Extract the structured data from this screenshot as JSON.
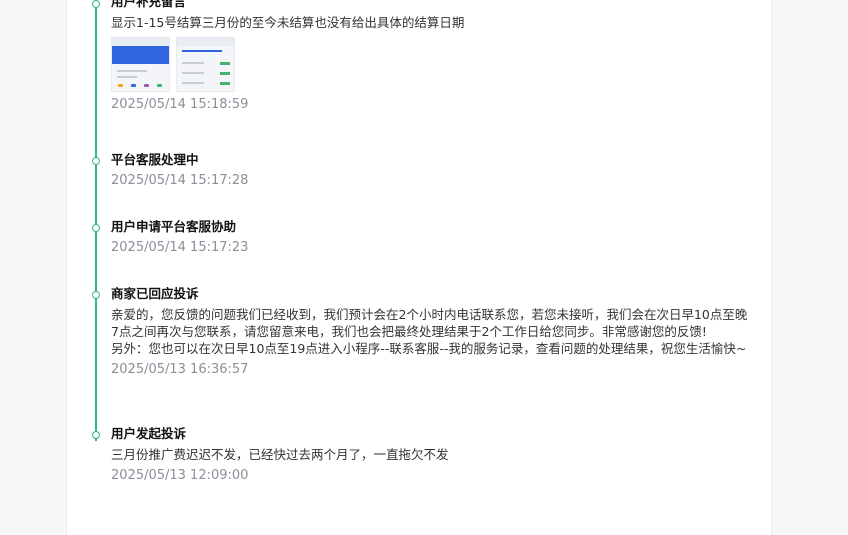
{
  "events": [
    {
      "title": "用户补充留言",
      "body": "显示1-15号结算三月份的至今未结算也没有给出具体的结算日期",
      "time": "2025/05/14 15:18:59",
      "attachments": [
        "screenshot-thumbnail-1",
        "screenshot-thumbnail-2"
      ]
    },
    {
      "title": "平台客服处理中",
      "time": "2025/05/14 15:17:28"
    },
    {
      "title": "用户申请平台客服协助",
      "time": "2025/05/14 15:17:23"
    },
    {
      "title": "商家已回应投诉",
      "body": "亲爱的，您反馈的问题我们已经收到，我们预计会在2个小时内电话联系您，若您未接听，我们会在次日早10点至晚7点之间再次与您联系，请您留意来电，我们也会把最终处理结果于2个工作日给您同步。非常感谢您的反馈!\n另外：您也可以在次日早10点至19点进入小程序--联系客服--我的服务记录，查看问题的处理结果，祝您生活愉快~",
      "time": "2025/05/13 16:36:57"
    },
    {
      "title": "用户发起投诉",
      "body": "三月份推广费迟迟不发，已经快过去两个月了，一直拖欠不发",
      "time": "2025/05/13 12:09:00"
    }
  ],
  "colors": {
    "timeline": "#2fba7a",
    "time_text": "#8a8f99"
  }
}
